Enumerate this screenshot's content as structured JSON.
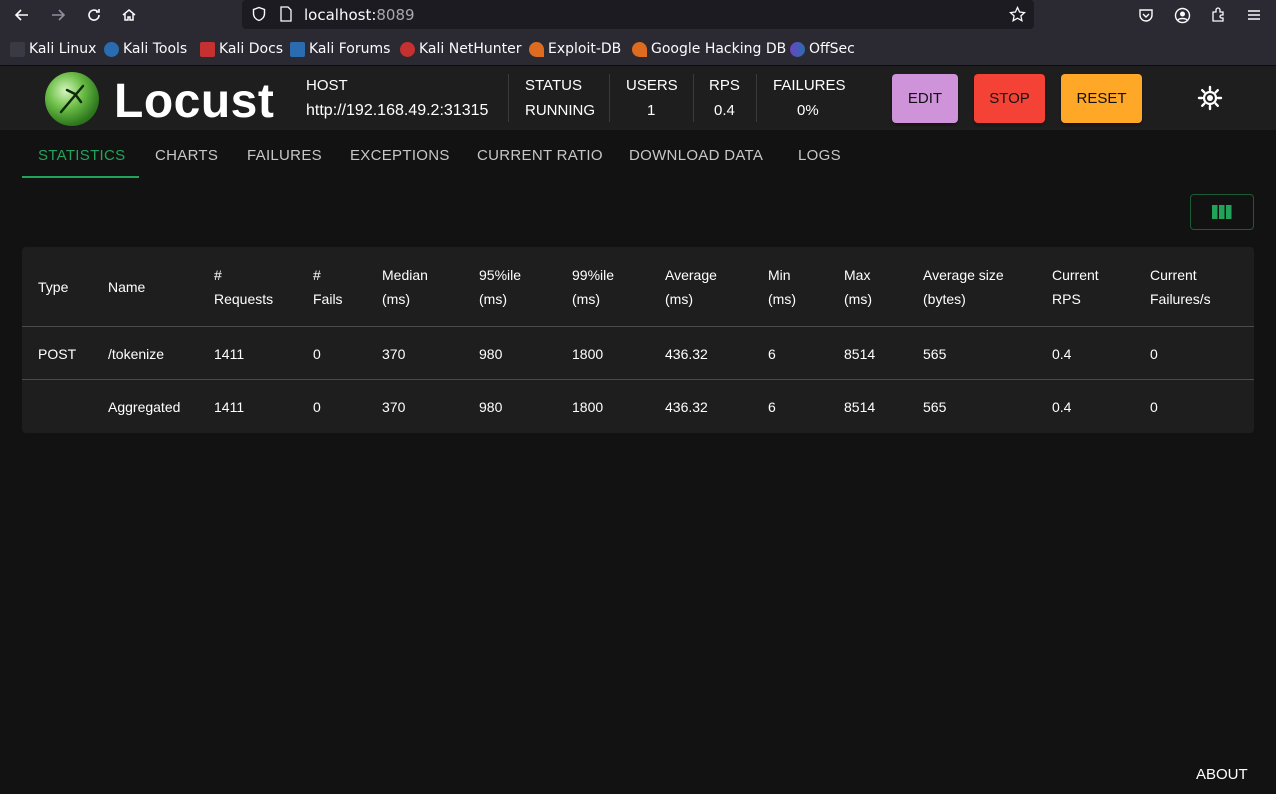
{
  "browser": {
    "url_host": "localhost:",
    "url_port": "8089",
    "bookmarks": [
      {
        "label": "Kali Linux",
        "color": "#1a1a1a"
      },
      {
        "label": "Kali Tools",
        "color": "#2b6cb0"
      },
      {
        "label": "Kali Docs",
        "color": "#c53030"
      },
      {
        "label": "Kali Forums",
        "color": "#2b6cb0"
      },
      {
        "label": "Kali NetHunter",
        "color": "#c53030"
      },
      {
        "label": "Exploit-DB",
        "color": "#dd6b20"
      },
      {
        "label": "Google Hacking DB",
        "color": "#dd6b20"
      },
      {
        "label": "OffSec",
        "color": "#6b46c1"
      }
    ]
  },
  "header": {
    "app_name": "Locust",
    "host_label": "HOST",
    "host_value": "http://192.168.49.2:31315",
    "status_label": "STATUS",
    "status_value": "RUNNING",
    "users_label": "USERS",
    "users_value": "1",
    "rps_label": "RPS",
    "rps_value": "0.4",
    "failures_label": "FAILURES",
    "failures_value": "0%",
    "edit_label": "EDIT",
    "stop_label": "STOP",
    "reset_label": "RESET",
    "colors": {
      "edit": "#ce93d8",
      "stop": "#f44336",
      "reset": "#ffa726"
    }
  },
  "tabs": [
    {
      "label": "STATISTICS",
      "active": true
    },
    {
      "label": "CHARTS"
    },
    {
      "label": "FAILURES"
    },
    {
      "label": "EXCEPTIONS"
    },
    {
      "label": "CURRENT RATIO"
    },
    {
      "label": "DOWNLOAD DATA"
    },
    {
      "label": "LOGS"
    }
  ],
  "table": {
    "headers": [
      [
        "Type",
        ""
      ],
      [
        "Name",
        ""
      ],
      [
        "#",
        "Requests"
      ],
      [
        "#",
        "Fails"
      ],
      [
        "Median",
        "(ms)"
      ],
      [
        "95%ile",
        "(ms)"
      ],
      [
        "99%ile",
        "(ms)"
      ],
      [
        "Average",
        "(ms)"
      ],
      [
        "Min",
        "(ms)"
      ],
      [
        "Max",
        "(ms)"
      ],
      [
        "Average size",
        "(bytes)"
      ],
      [
        "Current",
        "RPS"
      ],
      [
        "Current",
        "Failures/s"
      ]
    ],
    "rows": [
      [
        "POST",
        "/tokenize",
        "1411",
        "0",
        "370",
        "980",
        "1800",
        "436.32",
        "6",
        "8514",
        "565",
        "0.4",
        "0"
      ],
      [
        "",
        "Aggregated",
        "1411",
        "0",
        "370",
        "980",
        "1800",
        "436.32",
        "6",
        "8514",
        "565",
        "0.4",
        "0"
      ]
    ]
  },
  "footer": {
    "about_label": "ABOUT"
  },
  "accent": "#22a35a"
}
